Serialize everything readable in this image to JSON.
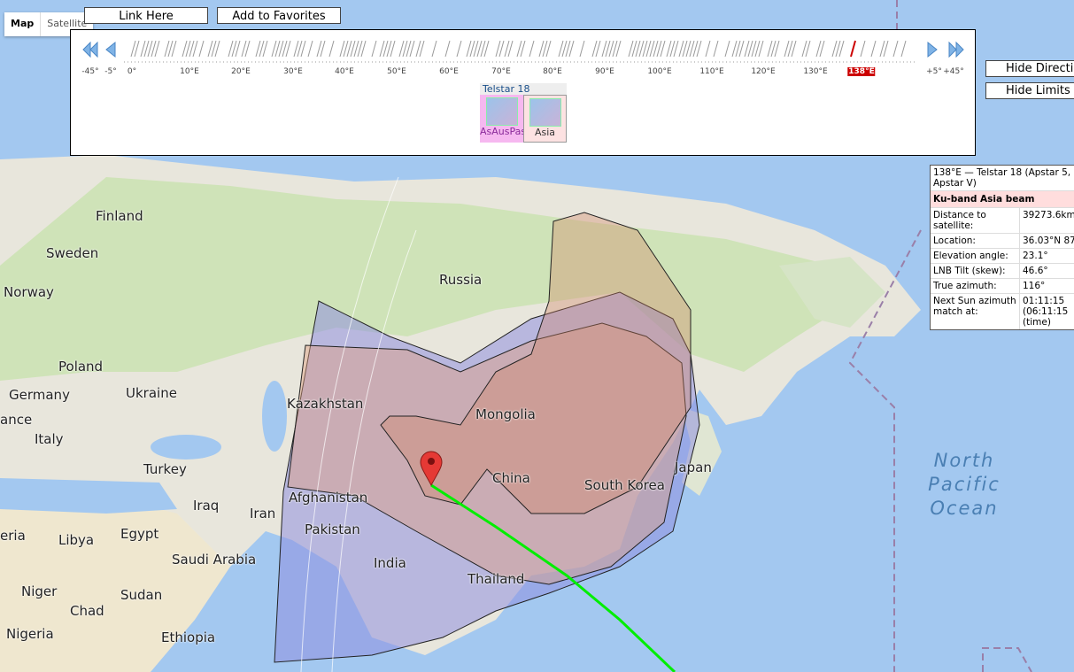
{
  "map_type": {
    "map": "Map",
    "satellite": "Satellite"
  },
  "top_buttons": {
    "link": "Link Here",
    "favorites": "Add to Favorites"
  },
  "side_buttons": {
    "directions": "Hide Directions",
    "limits": "Hide Limits"
  },
  "timeline": {
    "ticks": [
      "-45°",
      "-5°",
      "0°",
      "10°E",
      "20°E",
      "30°E",
      "40°E",
      "50°E",
      "60°E",
      "70°E",
      "80°E",
      "90°E",
      "100°E",
      "110°E",
      "120°E",
      "130°E",
      "+5°",
      "+45°"
    ],
    "selected": "138°E"
  },
  "satellite": {
    "name": "Telstar 18",
    "beams": [
      "AsAusPas",
      "Asia"
    ]
  },
  "info": {
    "header": "138°E — Telstar 18 (Apstar 5, Apstar V)",
    "beam": "Ku-band Asia beam",
    "rows": [
      {
        "k": "Distance to satellite:",
        "v": "39273.6km"
      },
      {
        "k": "Location:",
        "v": "36.03°N 87"
      },
      {
        "k": "Elevation angle:",
        "v": "23.1°"
      },
      {
        "k": "LNB Tilt (skew):",
        "v": "46.6°"
      },
      {
        "k": "True azimuth:",
        "v": "116°"
      },
      {
        "k": "Next Sun azimuth match at:",
        "v": "01:11:15 (06:11:15 (time)"
      }
    ]
  },
  "map_labels": [
    "Finland",
    "Sweden",
    "Norway",
    "Russia",
    "Poland",
    "Germany",
    "Ukraine",
    "ance",
    "Kazakhstan",
    "Mongolia",
    "Italy",
    "Turkey",
    "China",
    "Japan",
    "South Korea",
    "Iraq",
    "Iran",
    "Afghanistan",
    "Pakistan",
    "eria",
    "Libya",
    "Egypt",
    "Saudi Arabia",
    "India",
    "Niger",
    "Sudan",
    "Chad",
    "Thailand",
    "Nigeria",
    "Ethiopia"
  ],
  "ocean_label": "North Pacific Ocean",
  "colors": {
    "beam_outer": "#9090e0",
    "beam_inner": "#e0a080",
    "path": "#00ee00",
    "marker": "#e53935",
    "selected": "#cc0000"
  }
}
